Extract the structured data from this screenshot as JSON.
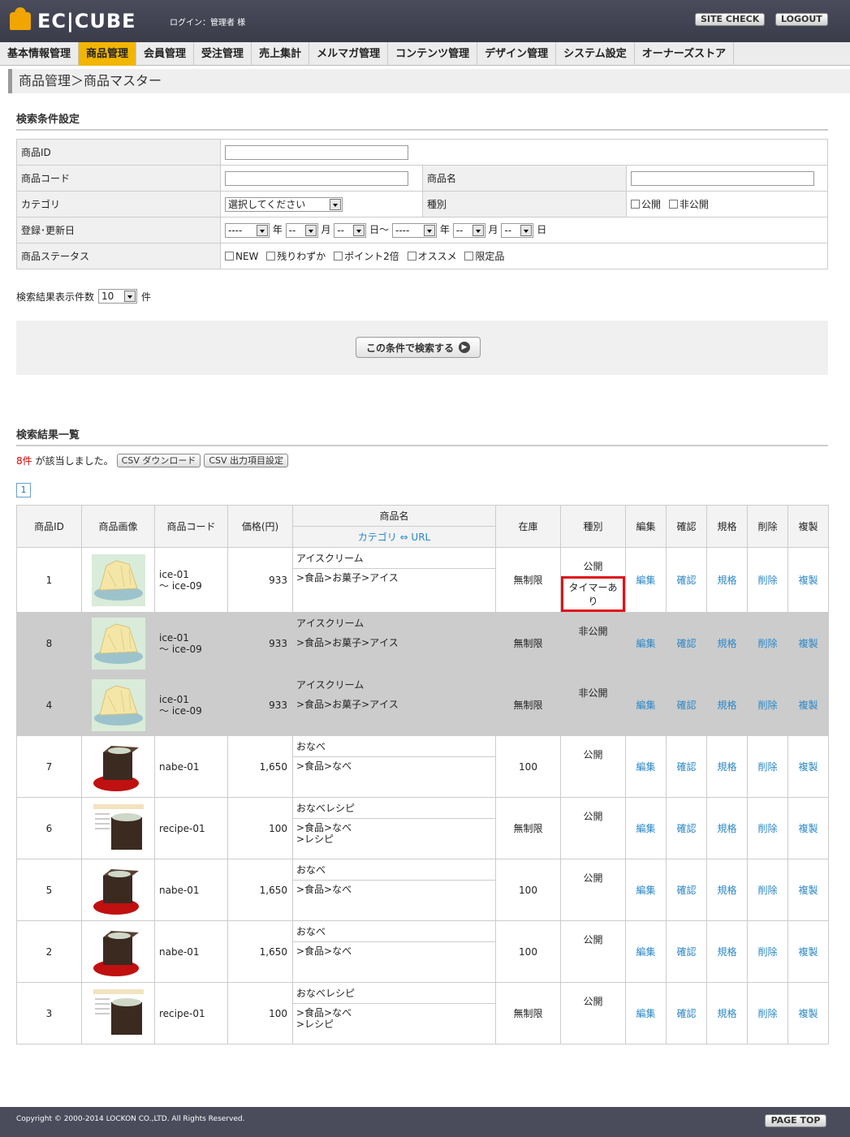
{
  "header": {
    "logo_text": "EC|CUBE",
    "login_info": "ログイン：管理者 様",
    "site_check": "SITE CHECK",
    "logout": "LOGOUT"
  },
  "nav": [
    "基本情報管理",
    "商品管理",
    "会員管理",
    "受注管理",
    "売上集計",
    "メルマガ管理",
    "コンテンツ管理",
    "デザイン管理",
    "システム設定",
    "オーナーズストア"
  ],
  "breadcrumb": "商品管理＞商品マスター",
  "search": {
    "title": "検索条件設定",
    "labels": {
      "product_id": "商品ID",
      "product_code": "商品コード",
      "product_name": "商品名",
      "category": "カテゴリ",
      "kind": "種別",
      "date": "登録･更新日",
      "status": "商品ステータス"
    },
    "category_select": "選択してください",
    "kind_options": [
      "公開",
      "非公開"
    ],
    "date_parts": {
      "year_empty": "----",
      "md_empty": "--",
      "year": "年",
      "month": "月",
      "day_from": "日〜",
      "day": "日"
    },
    "status_options": [
      "NEW",
      "残りわずか",
      "ポイント2倍",
      "オススメ",
      "限定品"
    ],
    "per_page_label": "検索結果表示件数",
    "per_page_value": "10",
    "per_page_unit": "件",
    "submit": "この条件で検索する"
  },
  "results": {
    "title": "検索結果一覧",
    "count": "8件",
    "count_suffix": "が該当しました。",
    "csv_download": "CSV ダウンロード",
    "csv_settings": "CSV 出力項目設定",
    "page": "1",
    "headers": {
      "id": "商品ID",
      "image": "商品画像",
      "code": "商品コード",
      "price": "価格(円)",
      "name": "商品名",
      "name_sub": "カテゴリ ⇔ URL",
      "stock": "在庫",
      "kind": "種別",
      "edit": "編集",
      "confirm": "確認",
      "spec": "規格",
      "delete": "削除",
      "copy": "複製"
    },
    "rows": [
      {
        "id": "1",
        "img": "ice",
        "code1": "ice-01",
        "code2": "〜 ice-09",
        "price": "933",
        "name": "アイスクリーム",
        "cat1": ">食品>お菓子>アイス",
        "cat2": "",
        "stock": "無制限",
        "kind": "公開",
        "timer": "タイマーあり",
        "gray": false
      },
      {
        "id": "8",
        "img": "ice",
        "code1": "ice-01",
        "code2": "〜 ice-09",
        "price": "933",
        "name": "アイスクリーム",
        "cat1": ">食品>お菓子>アイス",
        "cat2": "",
        "stock": "無制限",
        "kind": "非公開",
        "timer": "",
        "gray": true
      },
      {
        "id": "4",
        "img": "ice",
        "code1": "ice-01",
        "code2": "〜 ice-09",
        "price": "933",
        "name": "アイスクリーム",
        "cat1": ">食品>お菓子>アイス",
        "cat2": "",
        "stock": "無制限",
        "kind": "非公開",
        "timer": "",
        "gray": true
      },
      {
        "id": "7",
        "img": "nabe",
        "code1": "nabe-01",
        "code2": "",
        "price": "1,650",
        "name": "おなべ",
        "cat1": ">食品>なべ",
        "cat2": "",
        "stock": "100",
        "kind": "公開",
        "timer": "",
        "gray": false
      },
      {
        "id": "6",
        "img": "recipe",
        "code1": "recipe-01",
        "code2": "",
        "price": "100",
        "name": "おなべレシピ",
        "cat1": ">食品>なべ",
        "cat2": ">レシピ",
        "stock": "無制限",
        "kind": "公開",
        "timer": "",
        "gray": false
      },
      {
        "id": "5",
        "img": "nabe",
        "code1": "nabe-01",
        "code2": "",
        "price": "1,650",
        "name": "おなべ",
        "cat1": ">食品>なべ",
        "cat2": "",
        "stock": "100",
        "kind": "公開",
        "timer": "",
        "gray": false
      },
      {
        "id": "2",
        "img": "nabe",
        "code1": "nabe-01",
        "code2": "",
        "price": "1,650",
        "name": "おなべ",
        "cat1": ">食品>なべ",
        "cat2": "",
        "stock": "100",
        "kind": "公開",
        "timer": "",
        "gray": false
      },
      {
        "id": "3",
        "img": "recipe",
        "code1": "recipe-01",
        "code2": "",
        "price": "100",
        "name": "おなべレシピ",
        "cat1": ">食品>なべ",
        "cat2": ">レシピ",
        "stock": "無制限",
        "kind": "公開",
        "timer": "",
        "gray": false
      }
    ]
  },
  "footer": {
    "copyright": "Copyright © 2000-2014 LOCKON CO.,LTD. All Rights Reserved.",
    "page_top": "PAGE TOP"
  }
}
